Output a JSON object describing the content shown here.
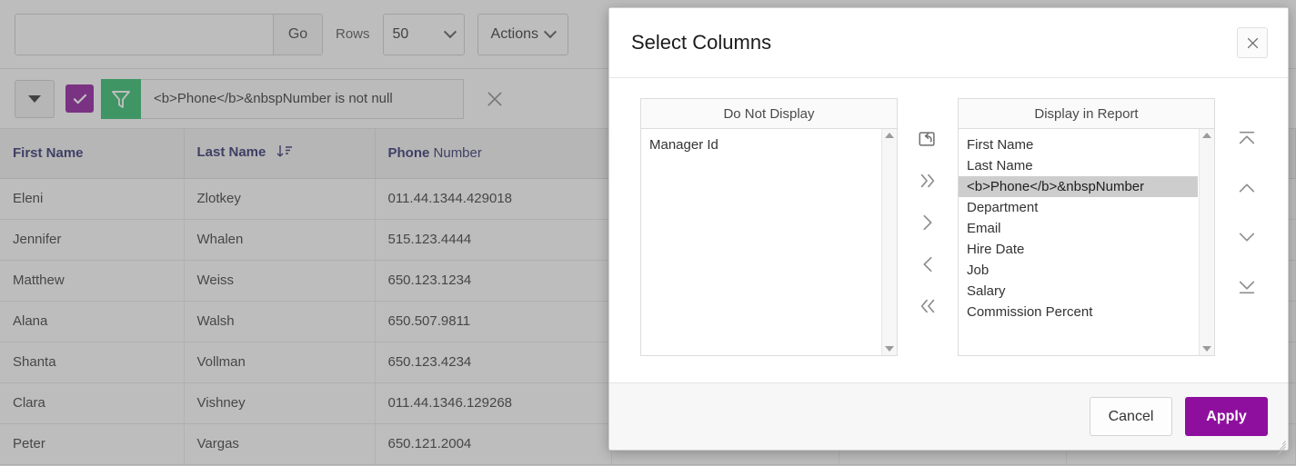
{
  "colors": {
    "accent_purple": "#8e0f9e",
    "checkbox_purple": "#8f189f",
    "filter_green": "#2ebd6b",
    "header_text": "#2e2e6e",
    "selected_row": "#cdcdcd"
  },
  "toolbar": {
    "search_value": "",
    "search_placeholder": "",
    "go_label": "Go",
    "rows_label": "Rows",
    "rows_value": "50",
    "actions_label": "Actions"
  },
  "filterbar": {
    "caret_icon": "caret-down-icon",
    "checkbox_icon": "check-icon",
    "funnel_icon": "filter-funnel-icon",
    "filter_text": "<b>Phone</b>&nbspNumber is not null",
    "remove_icon": "close-icon"
  },
  "report": {
    "columns": [
      {
        "label": "First Name",
        "bold_prefix": "",
        "sorted": false
      },
      {
        "label": "Last Name",
        "bold_prefix": "",
        "sorted": true
      },
      {
        "label": "Number",
        "bold_prefix": "Phone",
        "sorted": false
      }
    ],
    "sort_icon": "sort-ascending-icon",
    "rows": [
      {
        "first": "Eleni",
        "last": "Zlotkey",
        "phone": "011.44.1344.429018"
      },
      {
        "first": "Jennifer",
        "last": "Whalen",
        "phone": "515.123.4444"
      },
      {
        "first": "Matthew",
        "last": "Weiss",
        "phone": "650.123.1234"
      },
      {
        "first": "Alana",
        "last": "Walsh",
        "phone": "650.507.9811"
      },
      {
        "first": "Shanta",
        "last": "Vollman",
        "phone": "650.123.4234"
      },
      {
        "first": "Clara",
        "last": "Vishney",
        "phone": "011.44.1346.129268"
      },
      {
        "first": "Peter",
        "last": "Vargas",
        "phone": "650.121.2004"
      }
    ]
  },
  "dialog": {
    "title": "Select Columns",
    "close_icon": "close-icon",
    "do_not_display": {
      "heading": "Do Not Display",
      "items": [
        "Manager Id"
      ],
      "selected_index": -1
    },
    "display_in_report": {
      "heading": "Display in Report",
      "items": [
        "First Name",
        "Last Name",
        "<b>Phone</b>&nbspNumber",
        "Department",
        "Email",
        "Hire Date",
        "Job",
        "Salary",
        "Commission Percent"
      ],
      "selected_index": 2
    },
    "transfer_controls": [
      {
        "name": "reset-button",
        "icon": "reset-arrow-icon",
        "label": ""
      },
      {
        "name": "move-all-right-button",
        "icon": "double-chevron-right-icon",
        "label": ">>"
      },
      {
        "name": "move-right-button",
        "icon": "chevron-right-icon",
        "label": ">"
      },
      {
        "name": "move-left-button",
        "icon": "chevron-left-icon",
        "label": "<"
      },
      {
        "name": "move-all-left-button",
        "icon": "double-chevron-left-icon",
        "label": "<<"
      }
    ],
    "order_controls": [
      {
        "name": "move-to-top-button",
        "icon": "move-to-top-icon"
      },
      {
        "name": "move-up-button",
        "icon": "chevron-up-icon"
      },
      {
        "name": "move-down-button",
        "icon": "chevron-down-icon"
      },
      {
        "name": "move-to-bottom-button",
        "icon": "move-to-bottom-icon"
      }
    ],
    "cancel_label": "Cancel",
    "apply_label": "Apply"
  }
}
